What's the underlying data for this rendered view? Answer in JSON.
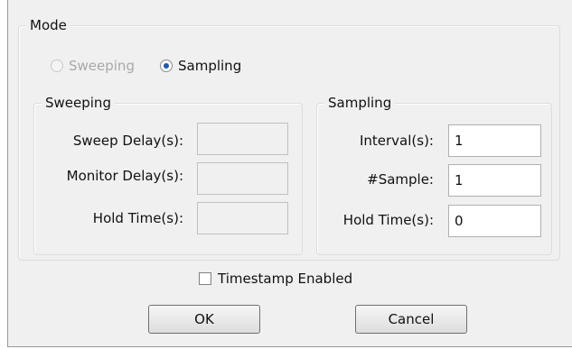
{
  "mode": {
    "title": "Mode",
    "options": [
      {
        "label": "Sweeping",
        "selected": false,
        "enabled": false
      },
      {
        "label": "Sampling",
        "selected": true,
        "enabled": true
      }
    ]
  },
  "sweeping": {
    "title": "Sweeping",
    "fields": [
      {
        "label": "Sweep Delay(s):",
        "value": ""
      },
      {
        "label": "Monitor Delay(s):",
        "value": ""
      },
      {
        "label": "Hold Time(s):",
        "value": ""
      }
    ]
  },
  "sampling": {
    "title": "Sampling",
    "fields": [
      {
        "label": "Interval(s):",
        "value": "1"
      },
      {
        "label": "#Sample:",
        "value": "1"
      },
      {
        "label": "Hold Time(s):",
        "value": "0"
      }
    ]
  },
  "timestamp": {
    "label": "Timestamp Enabled",
    "checked": false
  },
  "buttons": {
    "ok": "OK",
    "cancel": "Cancel"
  }
}
